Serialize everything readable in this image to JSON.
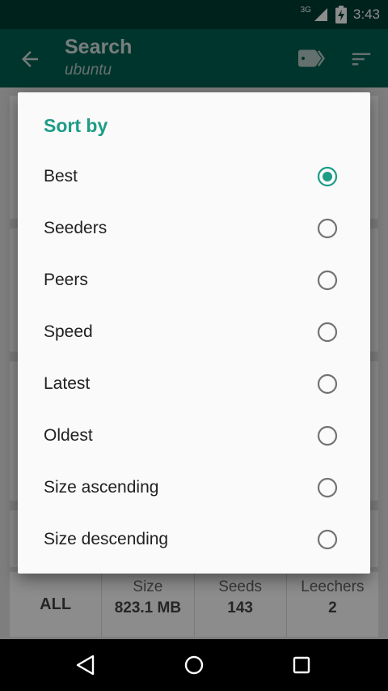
{
  "status_bar": {
    "network_type": "3G",
    "time": "3:43",
    "icons": [
      "signal-icon",
      "battery-charging-icon"
    ]
  },
  "app_bar": {
    "title": "Search",
    "subtitle": "ubuntu",
    "icons": [
      "back-arrow-icon",
      "tag-icon",
      "sort-icon"
    ]
  },
  "background": {
    "stats": {
      "all_label": "ALL",
      "size_label": "Size",
      "size_value": "823.1 MB",
      "seeds_label": "Seeds",
      "seeds_value": "143",
      "leechers_label": "Leechers",
      "leechers_value": "2"
    }
  },
  "dialog": {
    "title": "Sort by",
    "selected": "Best",
    "options": [
      {
        "label": "Best",
        "checked": true
      },
      {
        "label": "Seeders",
        "checked": false
      },
      {
        "label": "Peers",
        "checked": false
      },
      {
        "label": "Speed",
        "checked": false
      },
      {
        "label": "Latest",
        "checked": false
      },
      {
        "label": "Oldest",
        "checked": false
      },
      {
        "label": "Size ascending",
        "checked": false
      },
      {
        "label": "Size descending",
        "checked": false
      }
    ]
  },
  "nav_bar": {
    "icons": [
      "nav-back-icon",
      "nav-home-icon",
      "nav-recents-icon"
    ]
  },
  "colors": {
    "status_bar": "#003f35",
    "app_bar": "#006152",
    "accent": "#1d9c86",
    "radio_unchecked": "#737373"
  }
}
